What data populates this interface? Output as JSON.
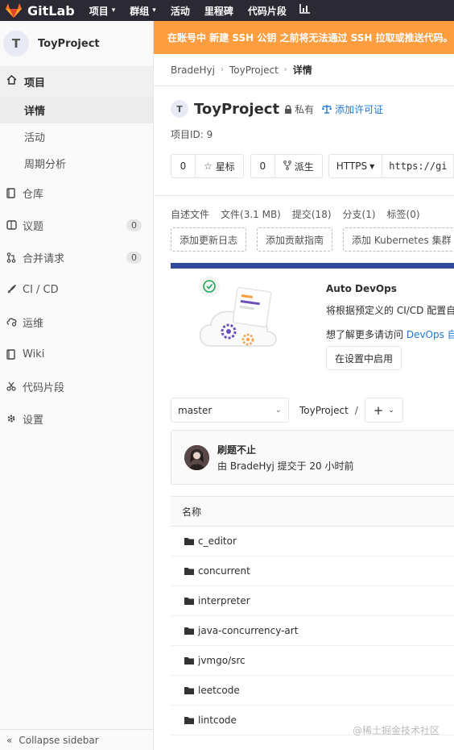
{
  "navbar": {
    "brand": "GitLab",
    "items": [
      {
        "label": "项目",
        "caret": true
      },
      {
        "label": "群组",
        "caret": true
      },
      {
        "label": "活动",
        "caret": false
      },
      {
        "label": "里程碑",
        "caret": false
      },
      {
        "label": "代码片段",
        "caret": false
      }
    ]
  },
  "sidebar": {
    "avatar_letter": "T",
    "project_name": "ToyProject",
    "section_label": "项目",
    "sub_items": [
      "详情",
      "活动",
      "周期分析"
    ],
    "items": [
      {
        "label": "仓库",
        "icon": "book-icon",
        "count": null
      },
      {
        "label": "议题",
        "icon": "issues-icon",
        "count": "0"
      },
      {
        "label": "合并请求",
        "icon": "merge-request-icon",
        "count": "0"
      },
      {
        "label": "CI / CD",
        "icon": "rocket-icon",
        "count": null
      },
      {
        "label": "运维",
        "icon": "cloud-gear-icon",
        "count": null
      },
      {
        "label": "Wiki",
        "icon": "book-icon",
        "count": null
      },
      {
        "label": "代码片段",
        "icon": "scissors-icon",
        "count": null
      },
      {
        "label": "设置",
        "icon": "gear-icon",
        "count": null
      }
    ],
    "collapse_label": "Collapse sidebar"
  },
  "alert": {
    "text": "在账号中 新建 SSH 公钥 之前将无法通过 SSH 拉取或推送代码。"
  },
  "breadcrumb": {
    "user": "BradeHyj",
    "project": "ToyProject",
    "current": "详情"
  },
  "project": {
    "avatar_letter": "T",
    "name": "ToyProject",
    "visibility": "私有",
    "license_link": "添加许可证",
    "id_label": "项目ID:",
    "id_value": "9"
  },
  "actions": {
    "star_count": "0",
    "star_label": "星标",
    "fork_count": "0",
    "fork_label": "派生",
    "protocol": "HTTPS",
    "clone_url": "https://gi"
  },
  "stats": {
    "readme": "自述文件",
    "files": "文件(3.1 MB)",
    "commits": "提交(18)",
    "branches": "分支(1)",
    "tags": "标签(0)"
  },
  "add_buttons": [
    "添加更新日志",
    "添加贡献指南",
    "添加 Kubernetes 集群"
  ],
  "devops": {
    "title": "Auto DevOps",
    "description": "将根据预定义的 CI/CD 配置自",
    "more_prefix": "想了解更多请访问 ",
    "more_link": "DevOps 自",
    "enable_button": "在设置中启用"
  },
  "repo": {
    "branch": "master",
    "path": "ToyProject",
    "separator": "/",
    "plus": "+"
  },
  "commit": {
    "message": "刷题不止",
    "meta": "由 BradeHyj 提交于 20 小时前"
  },
  "file_table": {
    "header": "名称",
    "rows": [
      "c_editor",
      "concurrent",
      "interpreter",
      "java-concurrency-art",
      "jvmgo/src",
      "leetcode",
      "lintcode"
    ]
  },
  "watermark": "@稀土掘金技术社区",
  "colors": {
    "navbar_bg": "#2b2a34",
    "alert_bg": "#fc9d40",
    "link": "#1f78d1",
    "progress": "#2f4a9a"
  }
}
